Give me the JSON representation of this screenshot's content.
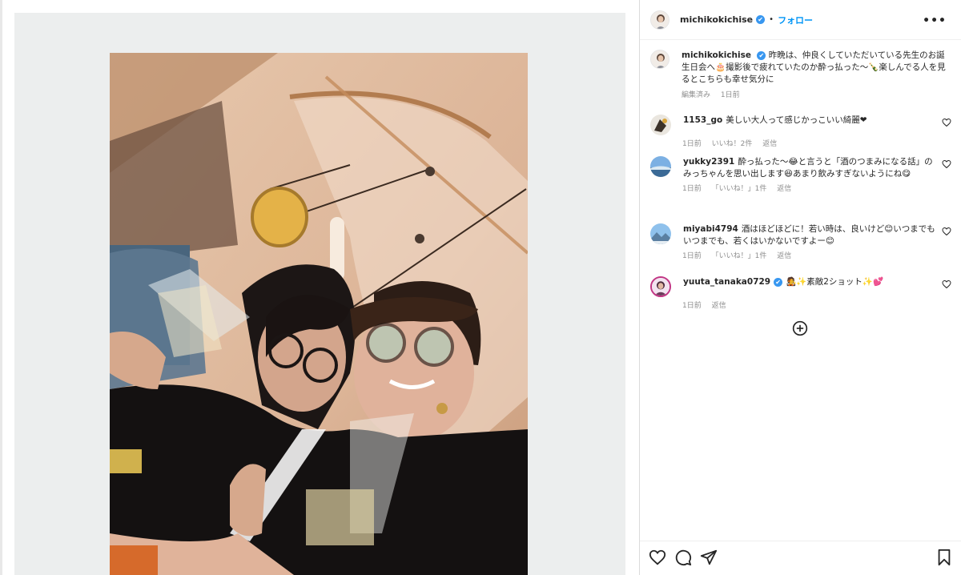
{
  "post": {
    "username": "michikokichise",
    "verified_mark": "✔",
    "separator": "•",
    "follow_label": "フォロー",
    "more_icon": "more-horizontal-icon"
  },
  "caption": {
    "username": "michikokichise",
    "text": "昨晩は、仲良くしていただいている先生のお誕生日会へ🎂撮影後で疲れていたのか酔っ払った〜🍾楽しんでる人を見るとこちらも幸せ気分に",
    "edited": "編集済み",
    "time": "1日前"
  },
  "comments": [
    {
      "username": "1153_go",
      "text": "美しい大人って感じかっこいい綺麗❤",
      "time": "1日前",
      "likes": "いいね！2件",
      "reply": "返信"
    },
    {
      "username": "yukky2391",
      "text": "酔っ払った〜😂と言うと「酒のつまみになる話」のみっちゃんを思い出します😆あまり飲みすぎないようにね😋",
      "time": "1日前",
      "likes": "「いいね！」1件",
      "reply": "返信"
    },
    {
      "username": "miyabi4794",
      "text": "酒はほどほどに！若い時は、良いけど😊いつまでもいつまでも、若くはいかないですよー😊",
      "time": "1日前",
      "likes": "「いいね！」1件",
      "reply": "返信"
    },
    {
      "username": "yuuta_tanaka0729",
      "text": "🧑‍🎤✨素敵2ショット✨💕",
      "time": "1日前",
      "reply": "返信"
    }
  ],
  "icons": {
    "load_more": "plus-circle-icon",
    "like": "heart-icon",
    "comment": "comment-icon",
    "share": "send-icon",
    "save": "bookmark-icon"
  },
  "colors": {
    "link": "#0095f6",
    "verified": "#3897f0",
    "muted": "#8e8e8e"
  }
}
